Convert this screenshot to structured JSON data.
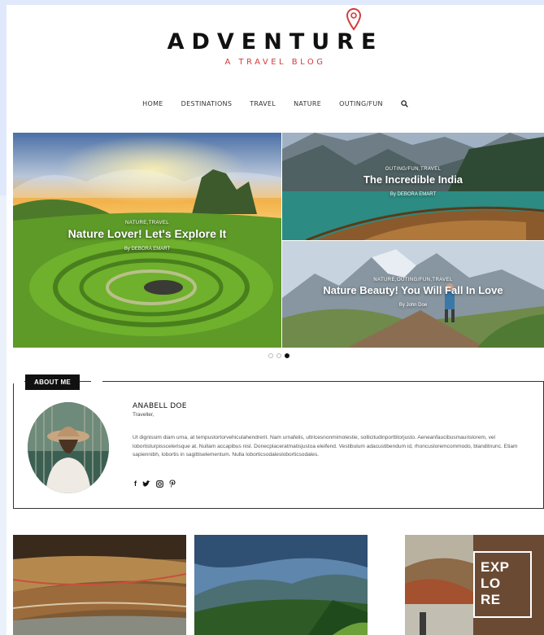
{
  "site": {
    "title": "ADVENTURE",
    "tagline": "A TRAVEL BLOG"
  },
  "nav": {
    "items": [
      "HOME",
      "DESTINATIONS",
      "TRAVEL",
      "NATURE",
      "OUTING/FUN"
    ],
    "search_icon": "search-icon"
  },
  "slider": {
    "main": {
      "category": "NATURE,TRAVEL",
      "title": "Nature Lover! Let's Explore It",
      "byline": "By DEBORA EMART"
    },
    "top_right": {
      "category": "OUTING/FUN,TRAVEL",
      "title": "The Incredible India",
      "byline": "By DEBORA EMART"
    },
    "bottom_right": {
      "category": "NATURE,OUTING/FUN,TRAVEL",
      "title": "Nature Beauty! You Will Fall In Love",
      "byline": "By John Doe"
    },
    "dots": 3,
    "active_dot": 2
  },
  "about": {
    "label": "ABOUT ME",
    "name": "ANABELL DOE",
    "role": "Traveller,",
    "text": "Ut dignissim diam urna, at tempustortorvehiculahendrerit. Nam urnafelis, ultricesnonmimolestie, sollicitudinporttitorjusto. Aeneanfaucibusmaurislorem, vel lobortisturpisscelerisque at. Nullam accapibus nisl. Donecplaceratmatisjustoa eleifend. Vestibulum adacustibendum id, rhoncusloremcommodo, blanditnunc. Etiam sapiennibh, lobortis in sagittiselementum. Nulla loborticsodalesloborticsodales.",
    "socials": [
      "f",
      "y",
      "ig",
      "p"
    ]
  },
  "thumbs": {
    "explore_text": [
      "EXP",
      "LO",
      "RE"
    ]
  },
  "colors": {
    "accent": "#d33c3c",
    "dark": "#111111"
  }
}
